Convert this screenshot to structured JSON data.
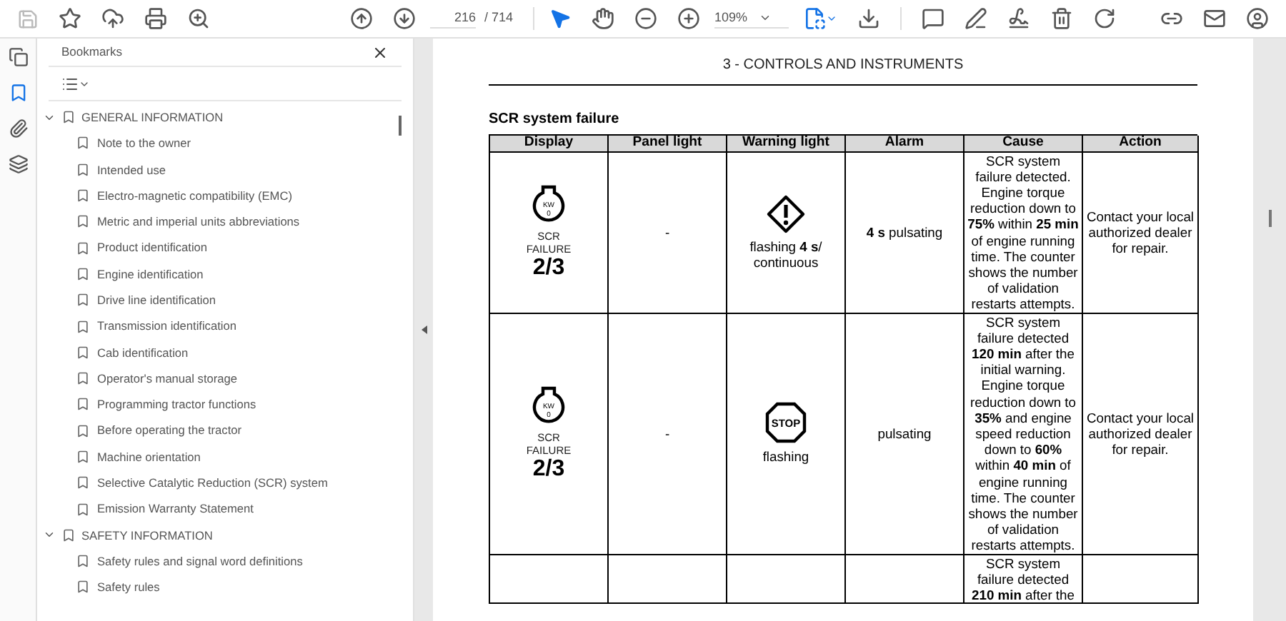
{
  "toolbar": {
    "page_current": "216",
    "page_total": "/ 714",
    "zoom": "109%",
    "disabled_save": true,
    "tools": [
      {
        "selected": true
      },
      {
        "selected": false
      }
    ]
  },
  "left_rail": [
    {
      "selected": false
    },
    {
      "selected": true
    },
    {
      "selected": false
    },
    {
      "selected": false
    }
  ],
  "bookmarks_panel": {
    "title": "Bookmarks",
    "items": [
      {
        "label": "GENERAL INFORMATION",
        "expanded": true,
        "children": [
          {
            "label": "Note to the owner"
          },
          {
            "label": "Intended use"
          },
          {
            "label": "Electro-magnetic compatibility (EMC)"
          },
          {
            "label": "Metric and imperial units abbreviations"
          },
          {
            "label": "Product identification"
          },
          {
            "label": "Engine identification"
          },
          {
            "label": "Drive line identification"
          },
          {
            "label": "Transmission identification"
          },
          {
            "label": "Cab identification"
          },
          {
            "label": "Operator's manual storage"
          },
          {
            "label": "Programming tractor functions"
          },
          {
            "label": "Before operating the tractor"
          },
          {
            "label": "Machine orientation"
          },
          {
            "label": "Selective Catalytic Reduction (SCR) system"
          },
          {
            "label": "Emission Warranty Statement"
          }
        ]
      },
      {
        "label": "SAFETY INFORMATION",
        "expanded": true,
        "children": [
          {
            "label": "Safety rules and signal word definitions"
          },
          {
            "label": "Safety rules"
          }
        ]
      }
    ]
  },
  "document": {
    "page_header": "3 - CONTROLS AND INSTRUMENTS",
    "section_title": "SCR system failure",
    "table": {
      "columns": [
        "Display",
        "Panel light",
        "Warning light",
        "Alarm",
        "Cause",
        "Action"
      ],
      "rows": [
        {
          "display": {
            "icon_lines": [
              "KW",
              "0"
            ],
            "label_lines": [
              "SCR",
              "FAILURE"
            ],
            "counter": "2/3"
          },
          "panel_light": "-",
          "warning_light": {
            "kind": "warning",
            "text": "flashing **4 s**/ continuous"
          },
          "alarm": "**4 s** pulsating",
          "cause": "SCR system failure detected. Engine torque reduction down to **75%** within **25 min** of engine running time. The counter shows the number of validation restarts attempts.",
          "action": "Contact your local authorized dealer for repair."
        },
        {
          "display": {
            "icon_lines": [
              "KW",
              "0"
            ],
            "label_lines": [
              "SCR",
              "FAILURE"
            ],
            "counter": "2/3"
          },
          "panel_light": "-",
          "warning_light": {
            "kind": "stop",
            "sign_text": "STOP",
            "text": "flashing"
          },
          "alarm": "pulsating",
          "cause": "SCR system failure detected **120 min** after the initial warning. Engine torque reduction down to **35%** and engine speed reduction down to **60%** within **40 min** of engine running time. The counter shows the number of validation restarts attempts.",
          "action": "Contact your local authorized dealer for repair."
        },
        {
          "cause": "SCR system failure detected **210 min** after the"
        }
      ]
    }
  }
}
